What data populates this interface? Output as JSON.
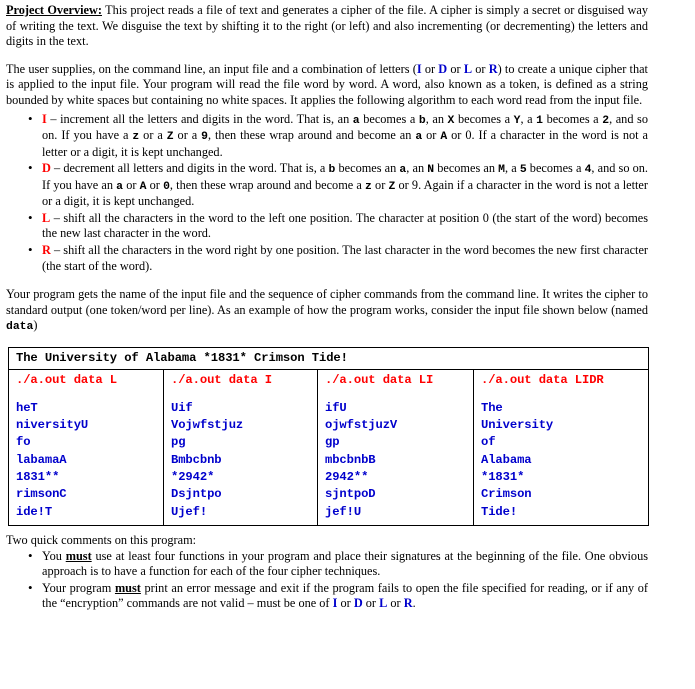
{
  "document": {
    "overview": {
      "heading": "Project Overview:",
      "text": "This project reads a file of text and generates a cipher of the file.  A cipher is simply a secret or disguised way of writing the text.  We disguise the text by shifting it to the right (or left) and also incrementing (or decrementing) the letters and digits in the text."
    },
    "intro": {
      "part1": "The user supplies, on the command line, an input file and a combination of letters (",
      "letter_i": "I",
      "sep1": " or ",
      "letter_d": "D",
      "sep2": " or ",
      "letter_l": "L",
      "sep3": " or ",
      "letter_r": "R",
      "part2": ") to create a unique cipher that is applied to the input file.  Your program will read the file word by word.  A word, also known as a token, is defined as a string bounded by white spaces but containing no white spaces.  It applies the following algorithm to each word read from the input file."
    },
    "rules": [
      {
        "letter": "I",
        "t1": " – increment all the letters and digits in the word.  That is, an ",
        "m1": "a",
        "t2": " becomes a ",
        "m2": "b",
        "t3": ", an ",
        "m3": "X",
        "t4": " becomes a ",
        "m4": "Y",
        "t5": ", a ",
        "m5": "1",
        "t6": " becomes a ",
        "m6": "2",
        "t7": ", and so on.  If you have a ",
        "m7": "z",
        "t8": " or a ",
        "m8": "Z",
        "t9": " or a ",
        "m9": "9",
        "t10": ", then these wrap around and become an ",
        "m10": "a",
        "t11": " or ",
        "m11": "A",
        "t12": " or 0. If a character in the word is not a letter or a digit, it is kept unchanged."
      },
      {
        "letter": "D",
        "t1": " – decrement all letters and digits in the word.  That is, a ",
        "m1": "b",
        "t2": " becomes an ",
        "m2": "a",
        "t3": ", an ",
        "m3": "N",
        "t4": " becomes an ",
        "m4": "M",
        "t5": ", a ",
        "m5": "5",
        "t6": " becomes a ",
        "m6": "4",
        "t7": ", and so on.  If you have an ",
        "m7": "a",
        "t8": " or ",
        "m8": "A",
        "t9": " or ",
        "m9": "0",
        "t10": ", then these wrap around and become a ",
        "m10": "z",
        "t11": " or ",
        "m11": "Z",
        "t12": " or 9. Again if a character in the word is not a letter or a digit, it is kept unchanged."
      },
      {
        "letter": "L",
        "text": " – shift all the characters in the word to the left one position.  The character at position 0 (the start of the word) becomes the new last character in the word."
      },
      {
        "letter": "R",
        "text": " – shift all the characters in the word right by one position.  The last character in the word becomes the new first character (the start of the word)."
      }
    ],
    "example_intro": {
      "part1": "Your program gets the name of the input file and the sequence of cipher commands from the command line.  It writes the cipher to standard output (one token/word per line).  As an example of how the program works, consider the input file shown below (named ",
      "filename": "data",
      "part2": ")"
    },
    "table": {
      "input_line": "The University of Alabama *1831* Crimson Tide!",
      "columns": [
        {
          "command": "./a.out data L",
          "output": [
            "heT",
            "niversityU",
            "fo",
            "labamaA",
            "1831**",
            "rimsonC",
            "ide!T"
          ]
        },
        {
          "command": "./a.out data I",
          "output": [
            "Uif",
            "Vojwfstjuz",
            "pg",
            "Bmbcbnb",
            "*2942*",
            "Dsjntpo",
            "Ujef!"
          ]
        },
        {
          "command": "./a.out data LI",
          "output": [
            "ifU",
            "ojwfstjuzV",
            "gp",
            "mbcbnbB",
            "2942**",
            "sjntpoD",
            "jef!U"
          ]
        },
        {
          "command": "./a.out data LIDR",
          "output": [
            "The",
            "University",
            "of",
            "Alabama",
            "*1831*",
            "Crimson",
            "Tide!"
          ]
        }
      ]
    },
    "comments": {
      "lead": "Two quick comments on this program:",
      "items": [
        {
          "t1": "You ",
          "emph": "must",
          "t2": " use at least four functions in your program and place their signatures at the beginning of the file. One obvious approach is to have a function for each of the four cipher techniques."
        },
        {
          "t1": "Your program ",
          "emph": "must",
          "t2": " print an error message and exit if the program fails to open the file specified for reading, or if any of the “encryption” commands are not valid – must be one of ",
          "letter_i": "I",
          "sep1": " or ",
          "letter_d": "D",
          "sep2": " or ",
          "letter_l": "L",
          "sep3": " or ",
          "letter_r": "R",
          "t3": "."
        }
      ]
    },
    "colors": {
      "command_red": "#FF0000",
      "output_blue": "#0000CC",
      "text_black": "#000000"
    }
  }
}
